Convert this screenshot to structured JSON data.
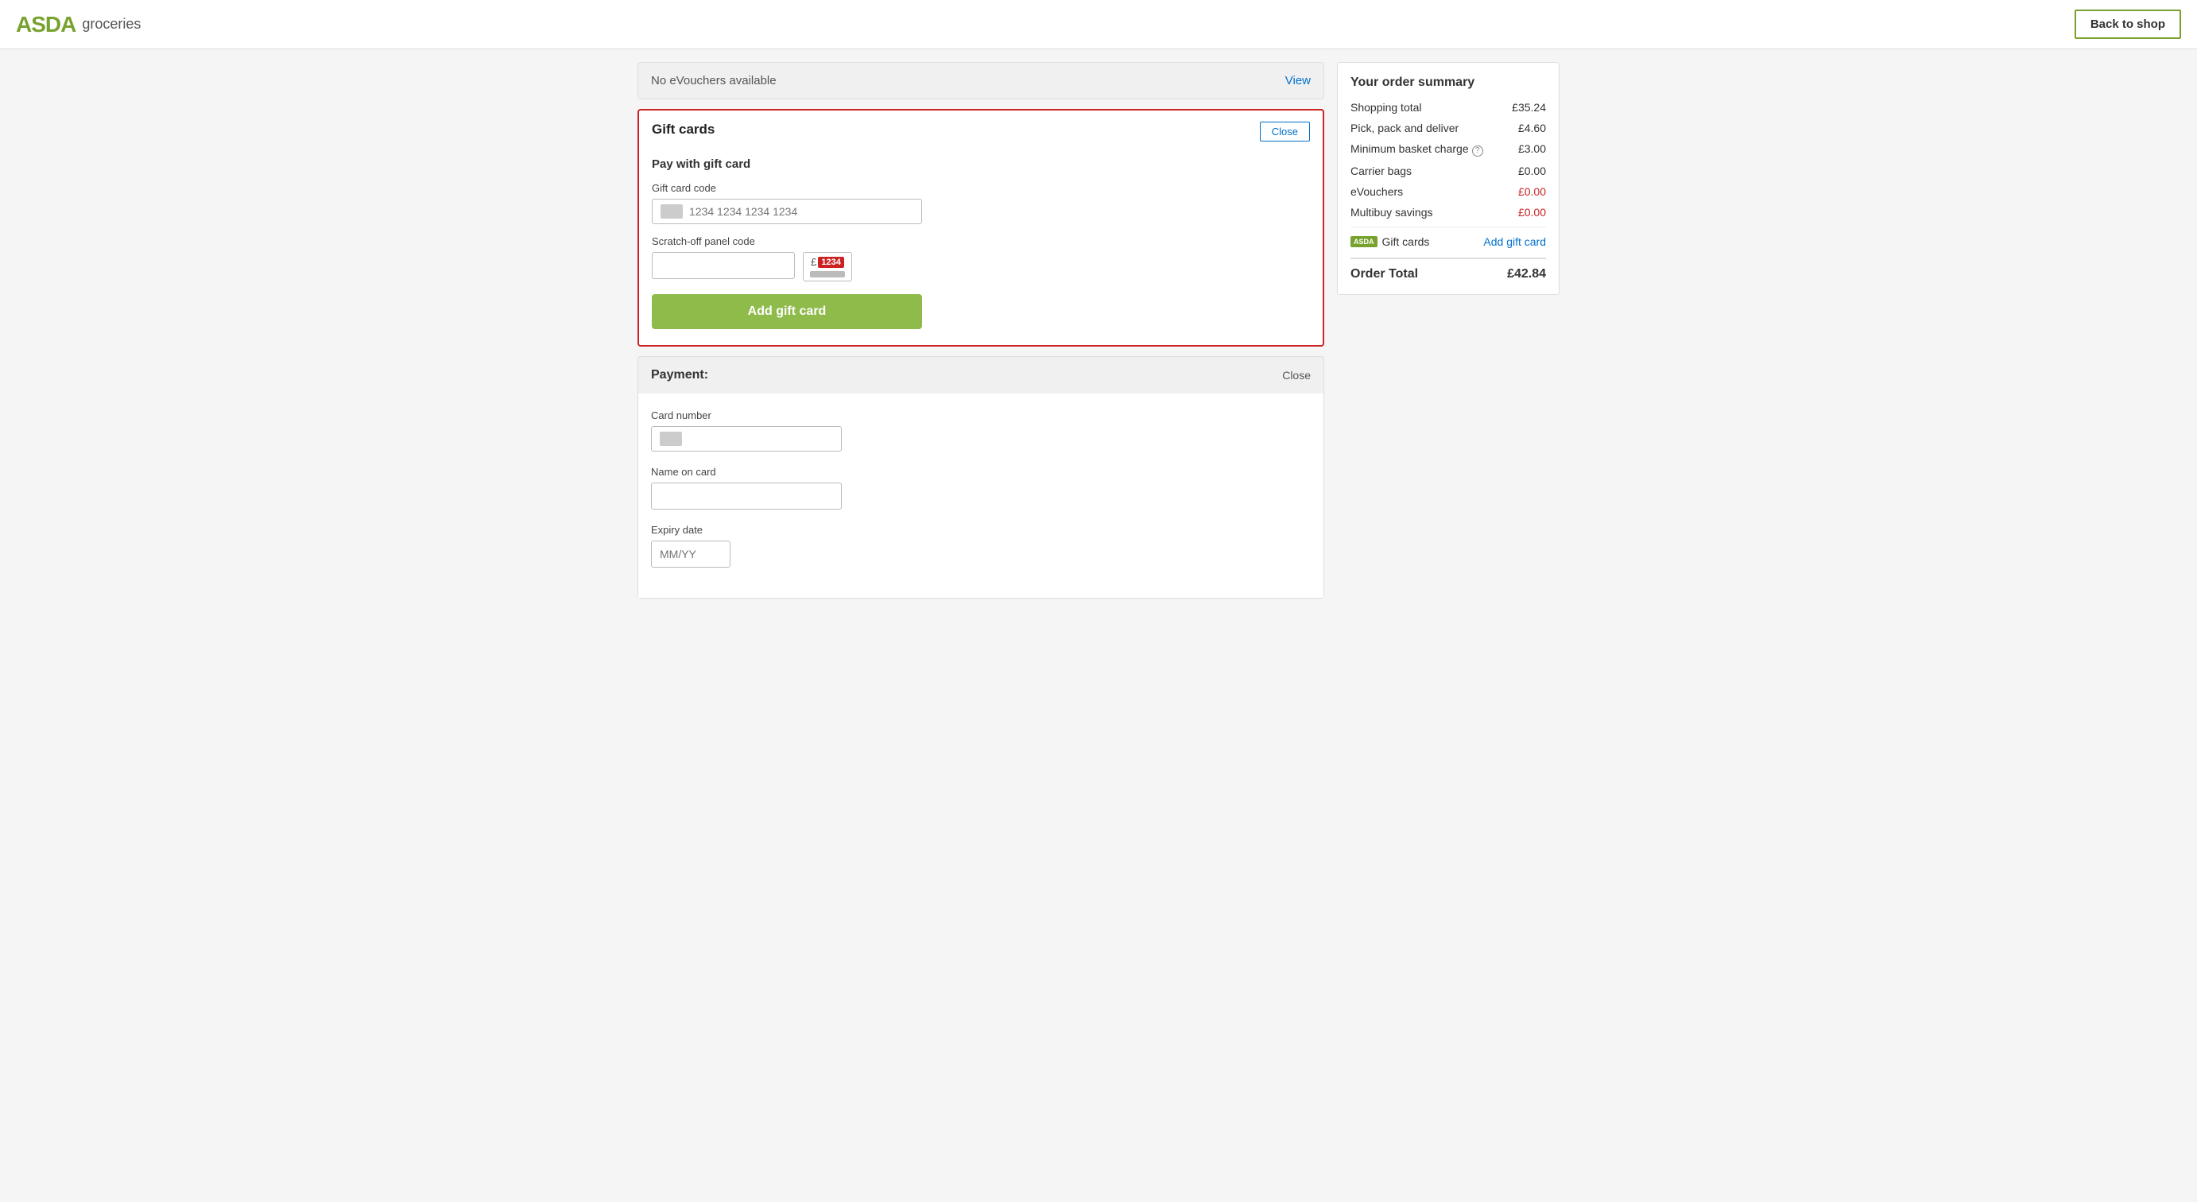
{
  "header": {
    "logo": "ASDA",
    "subtitle": "groceries",
    "back_to_shop": "Back to shop"
  },
  "evouchers": {
    "message": "No eVouchers available",
    "view_label": "View"
  },
  "gift_cards": {
    "title": "Gift cards",
    "close_label": "Close",
    "pay_with_label": "Pay with gift card",
    "card_code_label": "Gift card code",
    "card_code_placeholder": "1234 1234 1234 1234",
    "scratch_label": "Scratch-off panel code",
    "scratch_placeholder": "",
    "scratch_symbol": "£",
    "scratch_code": "1234",
    "add_button_label": "Add gift card"
  },
  "payment": {
    "title": "Payment:",
    "close_label": "Close",
    "card_number_label": "Card number",
    "card_number_placeholder": "",
    "name_on_card_label": "Name on card",
    "name_on_card_placeholder": "",
    "expiry_label": "Expiry date",
    "expiry_placeholder": "MM/YY"
  },
  "order_summary": {
    "title": "Your order summary",
    "rows": [
      {
        "label": "Shopping total",
        "value": "£35.24",
        "red": false
      },
      {
        "label": "Pick, pack and deliver",
        "value": "£4.60",
        "red": false
      },
      {
        "label": "Minimum basket charge",
        "value": "£3.00",
        "red": false,
        "help": true
      },
      {
        "label": "Carrier bags",
        "value": "£0.00",
        "red": false
      },
      {
        "label": "eVouchers",
        "value": "£0.00",
        "red": true
      },
      {
        "label": "Multibuy savings",
        "value": "£0.00",
        "red": true
      }
    ],
    "gift_cards_label": "Gift cards",
    "add_gift_card_label": "Add gift card",
    "order_total_label": "Order Total",
    "order_total_value": "£42.84",
    "asda_mini": "ASDA"
  }
}
